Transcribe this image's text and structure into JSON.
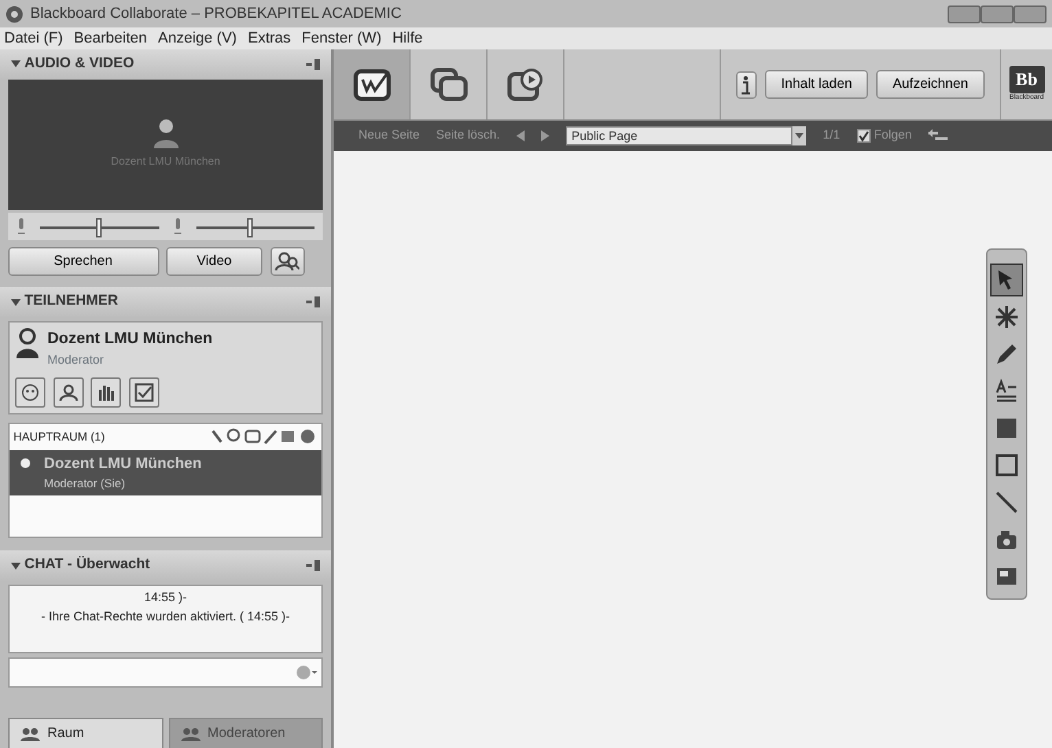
{
  "window": {
    "title": "Blackboard Collaborate – PROBEKAPITEL ACADEMIC"
  },
  "menu": [
    "Datei (F)",
    "Bearbeiten",
    "Anzeige (V)",
    "Extras",
    "Fenster (W)",
    "Hilfe"
  ],
  "audio_video": {
    "title": "AUDIO & VIDEO",
    "video_caption": "Dozent LMU München",
    "mic": {
      "level": 0.5
    },
    "speaker": {
      "level": 0.46
    },
    "buttons": [
      "Sprechen",
      "Video"
    ]
  },
  "participants": {
    "title": "TEILNEHMER",
    "user": {
      "name": "Dozent LMU München",
      "role": "Moderator"
    },
    "room": "HAUPTRAUM (1)",
    "list": [
      {
        "name": "Dozent LMU München",
        "role": "Moderator (Sie)",
        "selected": true
      }
    ]
  },
  "chat": {
    "title": "CHAT - Überwacht",
    "messages": [
      "14:55 )-",
      "- Ihre Chat-Rechte wurden aktiviert. ( 14:55 )-"
    ]
  },
  "bottom_tabs": [
    {
      "label": "Raum",
      "selected": true
    },
    {
      "label": "Moderatoren",
      "selected": false
    }
  ],
  "modes": [
    {
      "kind": "whiteboard",
      "selected": true
    },
    {
      "kind": "share",
      "selected": false
    },
    {
      "kind": "web",
      "selected": false
    }
  ],
  "toolbar": {
    "buttons": [
      "Inhalt laden",
      "Aufzeichnen"
    ]
  },
  "logo": {
    "text": "Bb",
    "subtext": "Blackboard"
  },
  "page_bar": {
    "new_page": "Neue Seite",
    "delete_page": "Seite lösch.",
    "page_name": "Public Page",
    "page_count": "1/1",
    "follow": {
      "label": "Folgen",
      "checked": true
    }
  },
  "tools": [
    {
      "kind": "select",
      "selected": true
    },
    {
      "kind": "laser",
      "selected": false
    },
    {
      "kind": "pen",
      "selected": false
    },
    {
      "kind": "text",
      "selected": false
    },
    {
      "kind": "fill",
      "selected": false
    },
    {
      "kind": "rect",
      "selected": false
    },
    {
      "kind": "line",
      "selected": false
    },
    {
      "kind": "camera",
      "selected": false
    },
    {
      "kind": "image",
      "selected": false
    }
  ]
}
